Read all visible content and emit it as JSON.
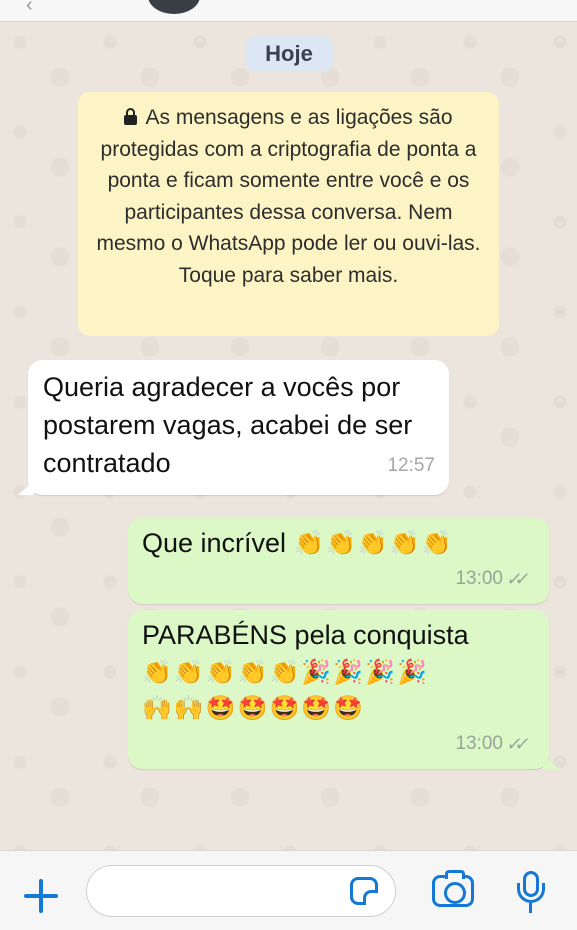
{
  "chat": {
    "date_label": "Hoje",
    "encryption_notice": "As mensagens e as ligações são protegidas com a criptografia de ponta a ponta e ficam somente entre você e os participantes dessa conversa. Nem mesmo o WhatsApp pode ler ou ouvi-las. Toque para saber mais.",
    "messages": [
      {
        "direction": "incoming",
        "text": "Queria agradecer a vocês por postarem vagas, acabei de ser contratado",
        "time": "12:57"
      },
      {
        "direction": "outgoing",
        "text": "Que incrível",
        "emoji": "👏👏👏👏👏",
        "time": "13:00",
        "status": "read"
      },
      {
        "direction": "outgoing",
        "text": "PARABÉNS pela conquista",
        "emoji_line_1": "👏👏👏👏👏🎉🎉🎉🎉",
        "emoji_line_2": "🙌🙌🤩🤩🤩🤩🤩",
        "time": "13:00",
        "status": "read"
      }
    ]
  },
  "composer": {
    "input_value": "",
    "icons": [
      "plus-icon",
      "sticker-icon",
      "camera-icon",
      "microphone-icon"
    ]
  },
  "colors": {
    "chat_background": "#ece5dd",
    "incoming_bubble": "#ffffff",
    "outgoing_bubble": "#dcf8c6",
    "notice_background": "#fdf4c5",
    "date_pill": "#dde7f3",
    "accent": "#1479d6"
  }
}
